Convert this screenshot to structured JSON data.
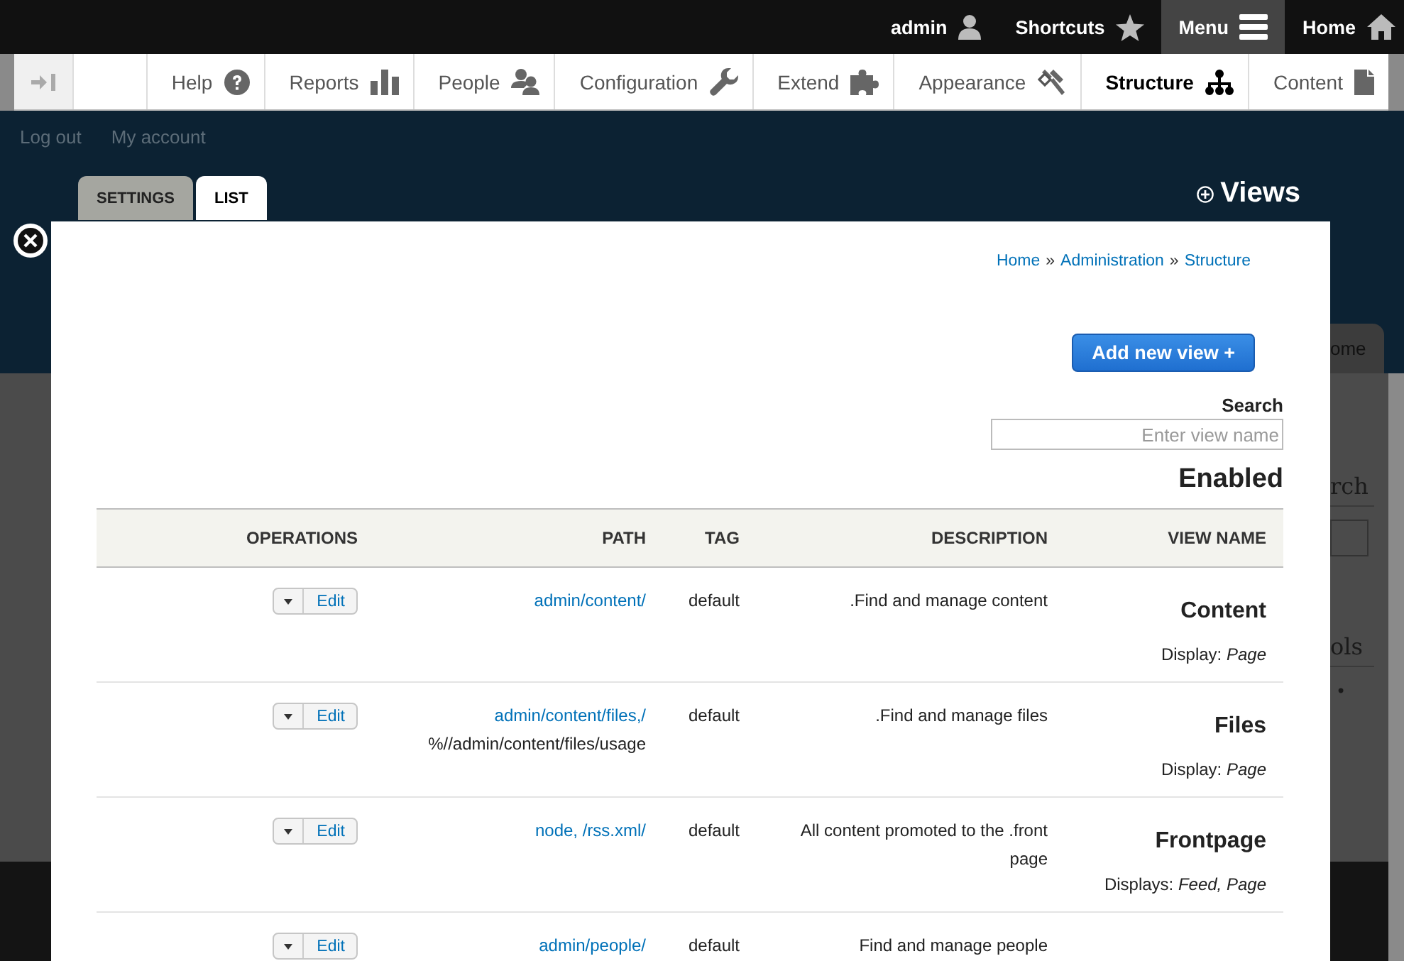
{
  "top_bar": {
    "items": [
      {
        "label": "admin",
        "selected": false
      },
      {
        "label": "Shortcuts",
        "selected": false
      },
      {
        "label": "Menu",
        "selected": true
      },
      {
        "label": "Home",
        "selected": false
      }
    ]
  },
  "tray": {
    "items": [
      {
        "label": "Help",
        "selected": false
      },
      {
        "label": "Reports",
        "selected": false
      },
      {
        "label": "People",
        "selected": false
      },
      {
        "label": "Configuration",
        "selected": false
      },
      {
        "label": "Extend",
        "selected": false
      },
      {
        "label": "Appearance",
        "selected": false
      },
      {
        "label": "Structure",
        "selected": true
      },
      {
        "label": "Content",
        "selected": false
      }
    ]
  },
  "user_links": [
    "Log out",
    "My account"
  ],
  "tabs": [
    {
      "label": "SETTINGS",
      "selected": false
    },
    {
      "label": "LIST",
      "selected": true
    }
  ],
  "page_title": "Views",
  "sidebar_fragments": {
    "tab": "ome",
    "block_title": "rch",
    "second_title": "ols",
    "bullet": "•"
  },
  "modal": {
    "breadcrumb": {
      "items": [
        "Home",
        "Administration",
        "Structure"
      ],
      "separator": "»"
    },
    "add_button": "Add new view +",
    "search": {
      "label": "Search",
      "placeholder": "Enter view name"
    },
    "section_title": "Enabled",
    "table": {
      "columns": [
        "OPERATIONS",
        "PATH",
        "TAG",
        "DESCRIPTION",
        "VIEW NAME"
      ],
      "rows": [
        {
          "name": "Content",
          "displays": "Display: *Page*",
          "description": ".Find and manage content",
          "tag": "default",
          "path": [
            {
              "kind": "link",
              "text": "admin/content/"
            }
          ],
          "operation": "Edit"
        },
        {
          "name": "Files",
          "displays": "Display: *Page*",
          "description": ".Find and manage files",
          "tag": "default",
          "path": [
            {
              "kind": "link",
              "text": "admin/content/files,/"
            },
            {
              "kind": "text",
              "text": "%//admin/content/files/usage"
            }
          ],
          "operation": "Edit"
        },
        {
          "name": "Frontpage",
          "displays": "Displays: *Feed, Page*",
          "description": "All content promoted to the .front page",
          "tag": "default",
          "path": [
            {
              "kind": "link",
              "text": "node, /rss.xml/"
            }
          ],
          "operation": "Edit"
        },
        {
          "description": "Find and manage people",
          "tag": "default",
          "path": [
            {
              "kind": "link",
              "text": "admin/people/"
            }
          ],
          "operation": "Edit"
        }
      ]
    }
  }
}
